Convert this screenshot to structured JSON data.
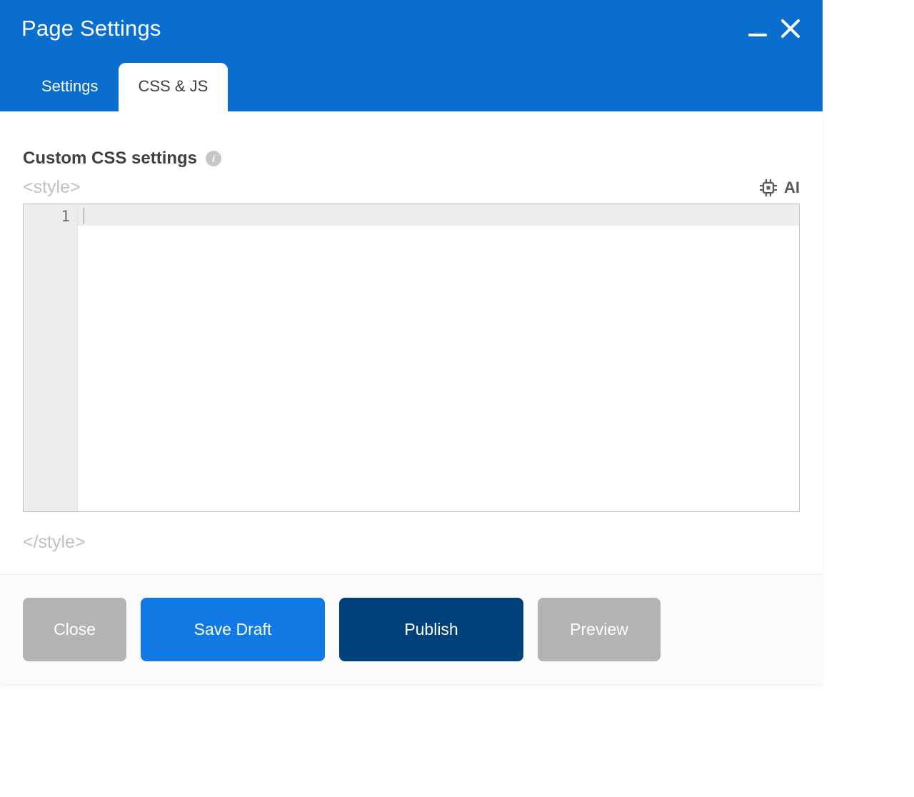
{
  "dialog": {
    "title": "Page Settings"
  },
  "tabs": {
    "settings": "Settings",
    "css_js": "CSS & JS"
  },
  "section": {
    "title": "Custom CSS settings",
    "open_tag": "<style>",
    "close_tag": "</style>"
  },
  "editor": {
    "line_number": "1"
  },
  "ai": {
    "label": "AI"
  },
  "buttons": {
    "close": "Close",
    "save_draft": "Save Draft",
    "publish": "Publish",
    "preview": "Preview"
  }
}
